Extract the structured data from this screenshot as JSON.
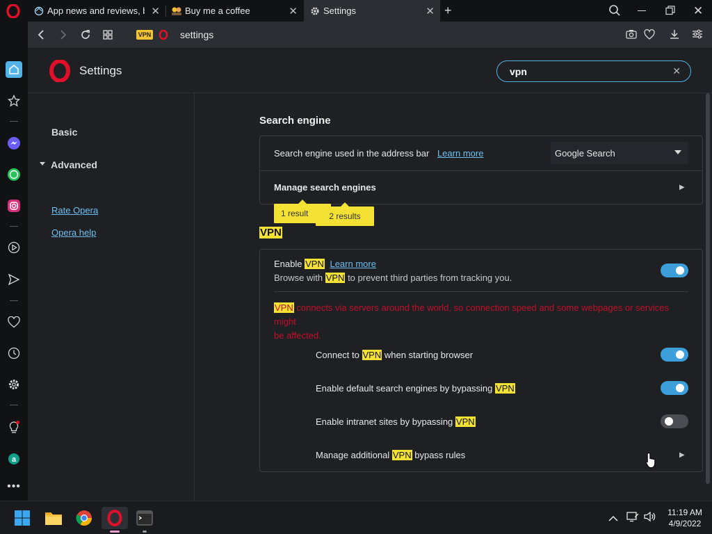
{
  "tabs": [
    {
      "title": "App news and reviews, best",
      "favicon": "refresh-globe-icon"
    },
    {
      "title": "Buy me a coffee",
      "favicon": "coffee-people-icon"
    },
    {
      "title": "Settings",
      "favicon": "gear-icon"
    }
  ],
  "address_bar": {
    "vpn_badge": "VPN",
    "url": "settings"
  },
  "header": {
    "title": "Settings",
    "search_value": "vpn"
  },
  "nav": {
    "basic": "Basic",
    "advanced": "Advanced",
    "rate_opera": "Rate Opera",
    "opera_help": "Opera help"
  },
  "search_engine": {
    "section_title": "Search engine",
    "address_bar_label": "Search engine used in the address bar",
    "learn_more": "Learn more",
    "selected_engine": "Google Search",
    "manage_label": "Manage search engines",
    "bubble_1": "1 result",
    "bubble_2": "2 results"
  },
  "vpn": {
    "section_title": "VPN",
    "enable_prefix": "Enable",
    "word": "VPN",
    "learn_more": "Learn more",
    "desc_prefix": "Browse with",
    "desc_suffix": "to prevent third parties from tracking you.",
    "warning_rest_1": "connects via servers around the world, so connection speed and some webpages or services might",
    "warning_line_2": "be affected.",
    "connect_prefix": "Connect to",
    "connect_suffix": "when starting browser",
    "default_search_label": "Enable default search engines by bypassing",
    "intranet_label": "Enable intranet sites by bypassing",
    "manage_prefix": "Manage additional",
    "manage_suffix": "bypass rules",
    "enable_vpn_on": true,
    "connect_on_start_on": true,
    "default_search_bypass_on": true,
    "intranet_bypass_on": false
  },
  "taskbar": {
    "time": "11:19 AM",
    "date": "4/9/2022"
  },
  "colors": {
    "accent": "#3c9fd9",
    "highlight": "#f3e134",
    "warning_red": "#c0102a",
    "opera_red": "#e0102a"
  }
}
